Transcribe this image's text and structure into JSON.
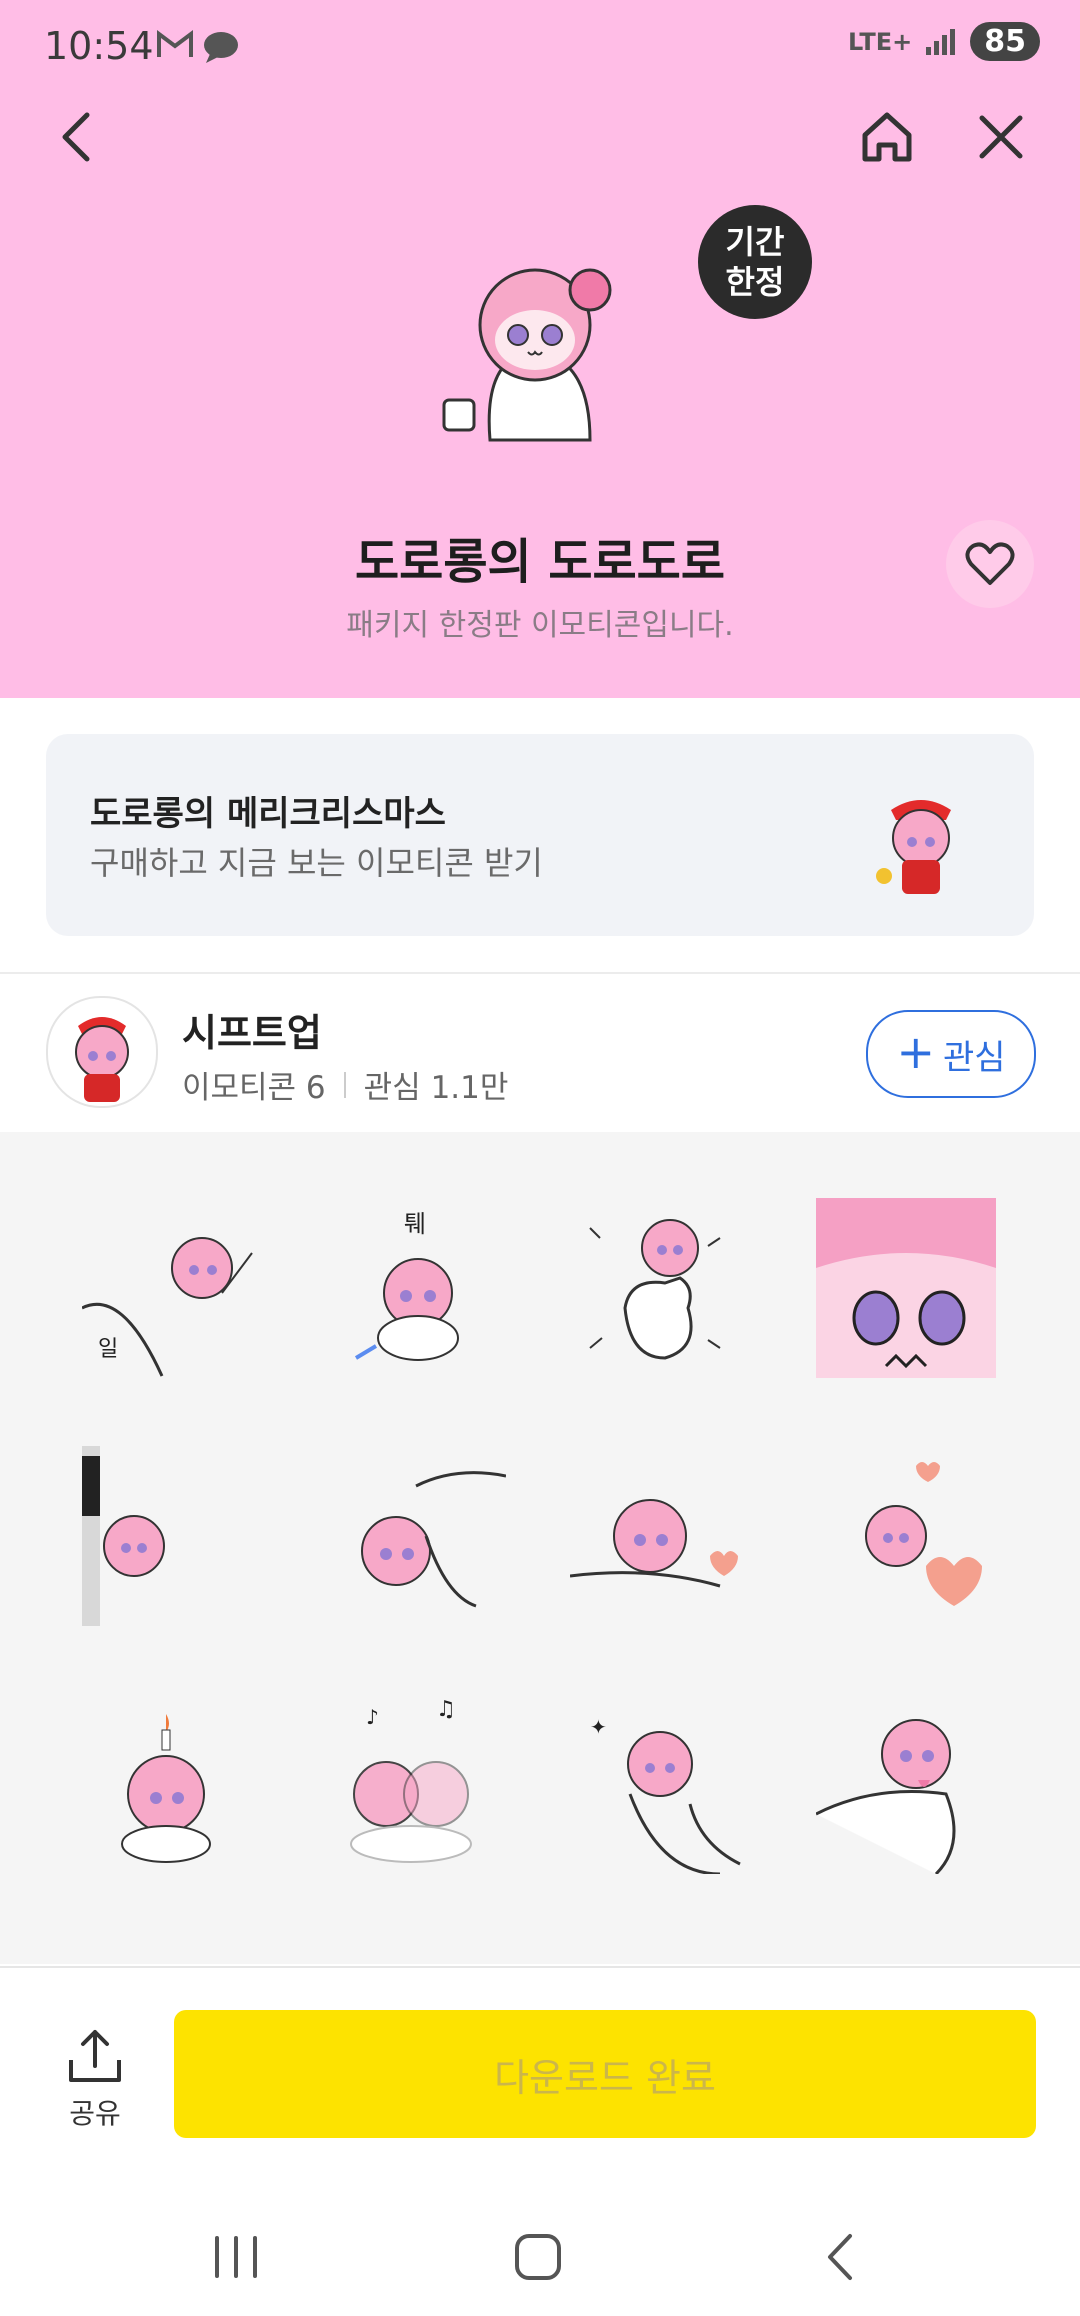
{
  "status_bar": {
    "time": "10:54",
    "network": "LTE+",
    "battery": "85"
  },
  "header": {
    "badge_line1": "기간",
    "badge_line2": "한정",
    "title": "도로롱의 도로도로",
    "subtitle": "패키지 한정판 이모티콘입니다.",
    "background_color": "#ffbde6"
  },
  "promo": {
    "title": "도로롱의 메리크리스마스",
    "subtitle": "구매하고 지금 보는 이모티콘 받기"
  },
  "author": {
    "name": "시프트업",
    "emoticon_count": "이모티콘 6",
    "interest_count": "관심 1.1만",
    "follow_label": "관심"
  },
  "stickers": {
    "text_1": "일",
    "text_2": "퉤"
  },
  "bottom_bar": {
    "share_label": "공유",
    "download_label": "다운로드 완료",
    "download_color": "#fde300"
  }
}
